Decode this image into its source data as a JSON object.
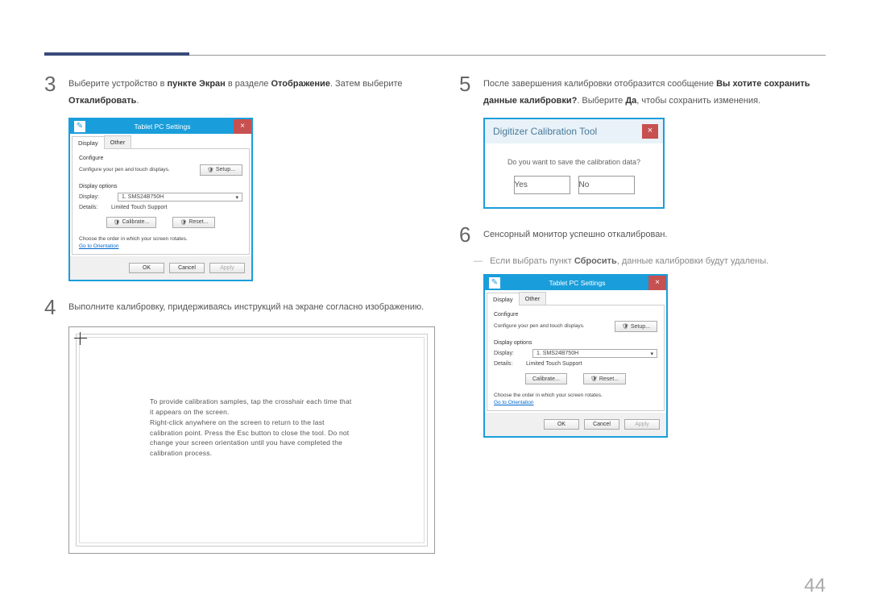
{
  "step3": {
    "num": "3",
    "text_before": "Выберите устройство в ",
    "bold1": "пункте Экран",
    "text_mid1": " в разделе ",
    "bold2": "Отображение",
    "text_mid2": ". Затем выберите ",
    "bold3": "Откалибровать",
    "text_end": "."
  },
  "winDialog": {
    "title": "Tablet PC Settings",
    "tab1": "Display",
    "tab2": "Other",
    "configure": "Configure",
    "configText": "Configure your pen and touch displays.",
    "setup": "Setup...",
    "dispOptions": "Display options",
    "displayLabel": "Display:",
    "displayValue": "1. SMS24B750H",
    "detailsLabel": "Details:",
    "detailsValue": "Limited Touch Support",
    "calibrate": "Calibrate...",
    "reset": "Reset...",
    "chooseText": "Choose the order in which your screen rotates.",
    "orientLink": "Go to Orientation",
    "ok": "OK",
    "cancel": "Cancel",
    "apply": "Apply"
  },
  "step4": {
    "num": "4",
    "text": "Выполните калибровку, придерживаясь инструкций на экране согласно изображению."
  },
  "calibScreen": {
    "line1": "To provide calibration samples, tap the crosshair each time that it appears on the screen.",
    "line2": "Right-click anywhere on the screen to return to the last calibration point. Press the Esc button to close the tool. Do not change your screen orientation until you have completed the calibration process."
  },
  "step5": {
    "num": "5",
    "text_before": "После завершения калибровки отобразится сообщение ",
    "bold1": "Вы хотите сохранить данные калибровки?",
    "text_mid": ". Выберите ",
    "bold2": "Да",
    "text_end": ", чтобы сохранить изменения."
  },
  "digDialog": {
    "title": "Digitizer Calibration Tool",
    "message": "Do you want to save the calibration data?",
    "yes": "Yes",
    "no": "No"
  },
  "step6": {
    "num": "6",
    "text": "Сенсорный монитор успешно откалиброван."
  },
  "note": {
    "text_before": "Если выбрать пункт ",
    "bold": "Сбросить",
    "text_after": ", данные калибровки будут удалены."
  },
  "pageNum": "44"
}
